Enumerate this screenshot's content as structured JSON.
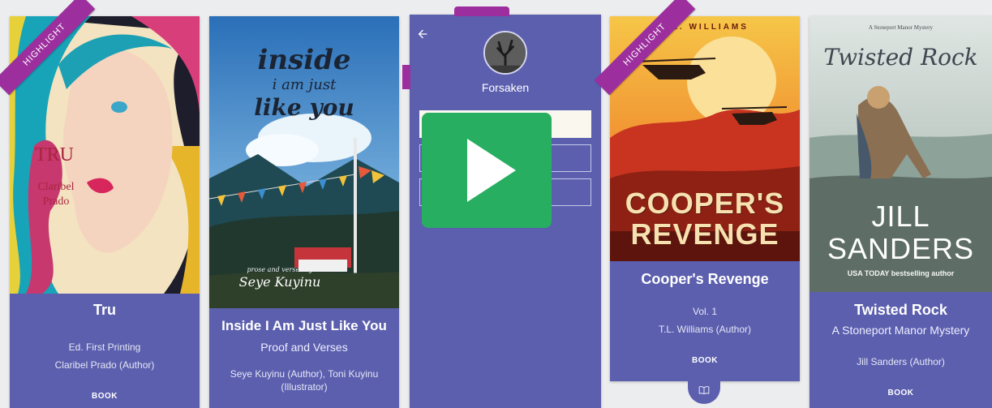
{
  "colors": {
    "card": "#5b5fae",
    "ribbon": "#9c2f9d",
    "play": "#27ae60",
    "background": "#ecedef"
  },
  "ribbon_label": "HIGHLIGHT",
  "cards": [
    {
      "title": "Tru",
      "subtitle": "Ed. First Printing",
      "authors": "Claribel Prado (Author)",
      "kind": "BOOK",
      "cover_title": "TRU",
      "cover_author_1": "Claribel",
      "cover_author_2": "Prado"
    },
    {
      "title": "Inside I Am Just Like You",
      "subtitle": "Proof and Verses",
      "authors_1": "Seye Kuyinu (Author), Toni Kuyinu",
      "authors_2": "(Illustrator)",
      "cover_title_1": "inside",
      "cover_title_2": "i am just",
      "cover_title_3": "like you",
      "cover_byline": "prose and verses by",
      "cover_author": "Seye Kuyinu"
    },
    {
      "name": "Forsaken",
      "back_icon": "arrow-left-icon"
    },
    {
      "title": "Cooper's Revenge",
      "subtitle": "Vol. 1",
      "authors": "T.L. Williams (Author)",
      "kind": "BOOK",
      "cover_author": "T.L. WILLIAMS",
      "cover_title_1": "COOPER'S",
      "cover_title_2": "REVENGE",
      "badge_icon": "open-book-icon"
    },
    {
      "title": "Twisted Rock",
      "subtitle": "A Stoneport Manor Mystery",
      "authors": "Jill Sanders (Author)",
      "kind": "BOOK",
      "cover_series": "A Stoneport Manor Mystery",
      "cover_title": "Twisted Rock",
      "cover_author_1": "JILL",
      "cover_author_2": "SANDERS",
      "cover_tagline": "USA TODAY bestselling author"
    }
  ],
  "overlay": {
    "icon": "play-icon"
  }
}
